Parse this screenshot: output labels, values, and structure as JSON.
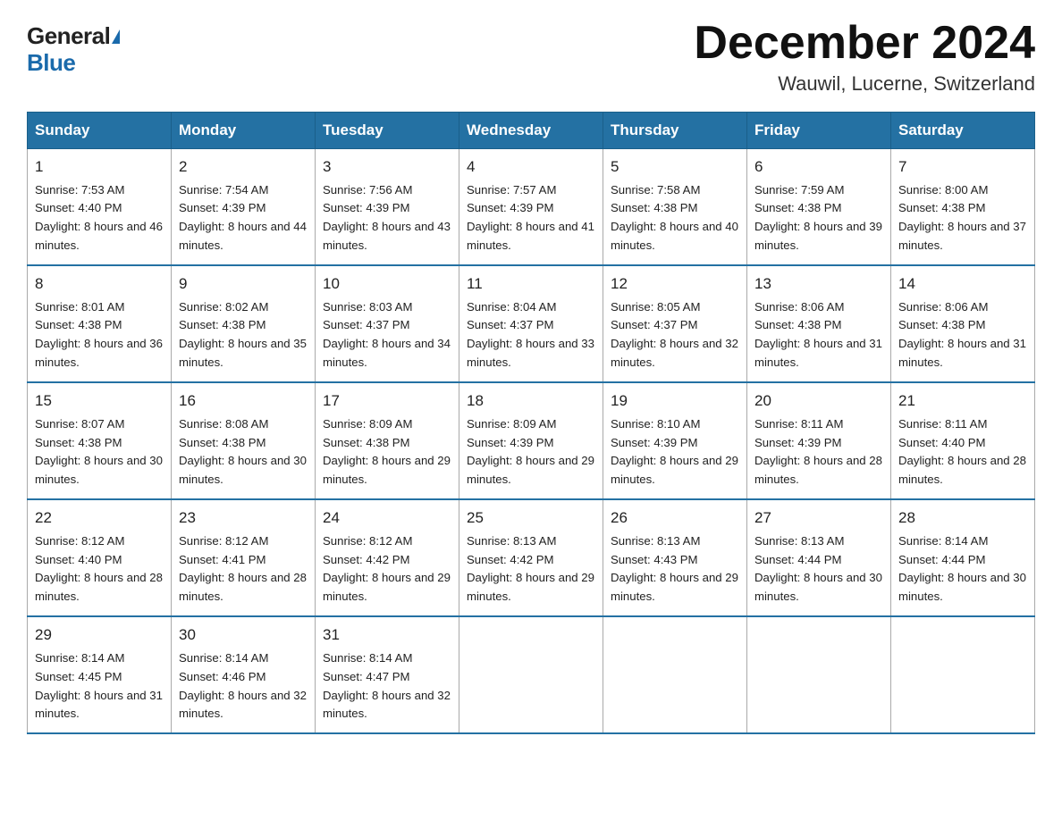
{
  "logo": {
    "general": "General",
    "blue": "Blue"
  },
  "title": "December 2024",
  "location": "Wauwil, Lucerne, Switzerland",
  "days_of_week": [
    "Sunday",
    "Monday",
    "Tuesday",
    "Wednesday",
    "Thursday",
    "Friday",
    "Saturday"
  ],
  "weeks": [
    [
      {
        "day": "1",
        "sunrise": "7:53 AM",
        "sunset": "4:40 PM",
        "daylight": "8 hours and 46 minutes."
      },
      {
        "day": "2",
        "sunrise": "7:54 AM",
        "sunset": "4:39 PM",
        "daylight": "8 hours and 44 minutes."
      },
      {
        "day": "3",
        "sunrise": "7:56 AM",
        "sunset": "4:39 PM",
        "daylight": "8 hours and 43 minutes."
      },
      {
        "day": "4",
        "sunrise": "7:57 AM",
        "sunset": "4:39 PM",
        "daylight": "8 hours and 41 minutes."
      },
      {
        "day": "5",
        "sunrise": "7:58 AM",
        "sunset": "4:38 PM",
        "daylight": "8 hours and 40 minutes."
      },
      {
        "day": "6",
        "sunrise": "7:59 AM",
        "sunset": "4:38 PM",
        "daylight": "8 hours and 39 minutes."
      },
      {
        "day": "7",
        "sunrise": "8:00 AM",
        "sunset": "4:38 PM",
        "daylight": "8 hours and 37 minutes."
      }
    ],
    [
      {
        "day": "8",
        "sunrise": "8:01 AM",
        "sunset": "4:38 PM",
        "daylight": "8 hours and 36 minutes."
      },
      {
        "day": "9",
        "sunrise": "8:02 AM",
        "sunset": "4:38 PM",
        "daylight": "8 hours and 35 minutes."
      },
      {
        "day": "10",
        "sunrise": "8:03 AM",
        "sunset": "4:37 PM",
        "daylight": "8 hours and 34 minutes."
      },
      {
        "day": "11",
        "sunrise": "8:04 AM",
        "sunset": "4:37 PM",
        "daylight": "8 hours and 33 minutes."
      },
      {
        "day": "12",
        "sunrise": "8:05 AM",
        "sunset": "4:37 PM",
        "daylight": "8 hours and 32 minutes."
      },
      {
        "day": "13",
        "sunrise": "8:06 AM",
        "sunset": "4:38 PM",
        "daylight": "8 hours and 31 minutes."
      },
      {
        "day": "14",
        "sunrise": "8:06 AM",
        "sunset": "4:38 PM",
        "daylight": "8 hours and 31 minutes."
      }
    ],
    [
      {
        "day": "15",
        "sunrise": "8:07 AM",
        "sunset": "4:38 PM",
        "daylight": "8 hours and 30 minutes."
      },
      {
        "day": "16",
        "sunrise": "8:08 AM",
        "sunset": "4:38 PM",
        "daylight": "8 hours and 30 minutes."
      },
      {
        "day": "17",
        "sunrise": "8:09 AM",
        "sunset": "4:38 PM",
        "daylight": "8 hours and 29 minutes."
      },
      {
        "day": "18",
        "sunrise": "8:09 AM",
        "sunset": "4:39 PM",
        "daylight": "8 hours and 29 minutes."
      },
      {
        "day": "19",
        "sunrise": "8:10 AM",
        "sunset": "4:39 PM",
        "daylight": "8 hours and 29 minutes."
      },
      {
        "day": "20",
        "sunrise": "8:11 AM",
        "sunset": "4:39 PM",
        "daylight": "8 hours and 28 minutes."
      },
      {
        "day": "21",
        "sunrise": "8:11 AM",
        "sunset": "4:40 PM",
        "daylight": "8 hours and 28 minutes."
      }
    ],
    [
      {
        "day": "22",
        "sunrise": "8:12 AM",
        "sunset": "4:40 PM",
        "daylight": "8 hours and 28 minutes."
      },
      {
        "day": "23",
        "sunrise": "8:12 AM",
        "sunset": "4:41 PM",
        "daylight": "8 hours and 28 minutes."
      },
      {
        "day": "24",
        "sunrise": "8:12 AM",
        "sunset": "4:42 PM",
        "daylight": "8 hours and 29 minutes."
      },
      {
        "day": "25",
        "sunrise": "8:13 AM",
        "sunset": "4:42 PM",
        "daylight": "8 hours and 29 minutes."
      },
      {
        "day": "26",
        "sunrise": "8:13 AM",
        "sunset": "4:43 PM",
        "daylight": "8 hours and 29 minutes."
      },
      {
        "day": "27",
        "sunrise": "8:13 AM",
        "sunset": "4:44 PM",
        "daylight": "8 hours and 30 minutes."
      },
      {
        "day": "28",
        "sunrise": "8:14 AM",
        "sunset": "4:44 PM",
        "daylight": "8 hours and 30 minutes."
      }
    ],
    [
      {
        "day": "29",
        "sunrise": "8:14 AM",
        "sunset": "4:45 PM",
        "daylight": "8 hours and 31 minutes."
      },
      {
        "day": "30",
        "sunrise": "8:14 AM",
        "sunset": "4:46 PM",
        "daylight": "8 hours and 32 minutes."
      },
      {
        "day": "31",
        "sunrise": "8:14 AM",
        "sunset": "4:47 PM",
        "daylight": "8 hours and 32 minutes."
      },
      null,
      null,
      null,
      null
    ]
  ]
}
